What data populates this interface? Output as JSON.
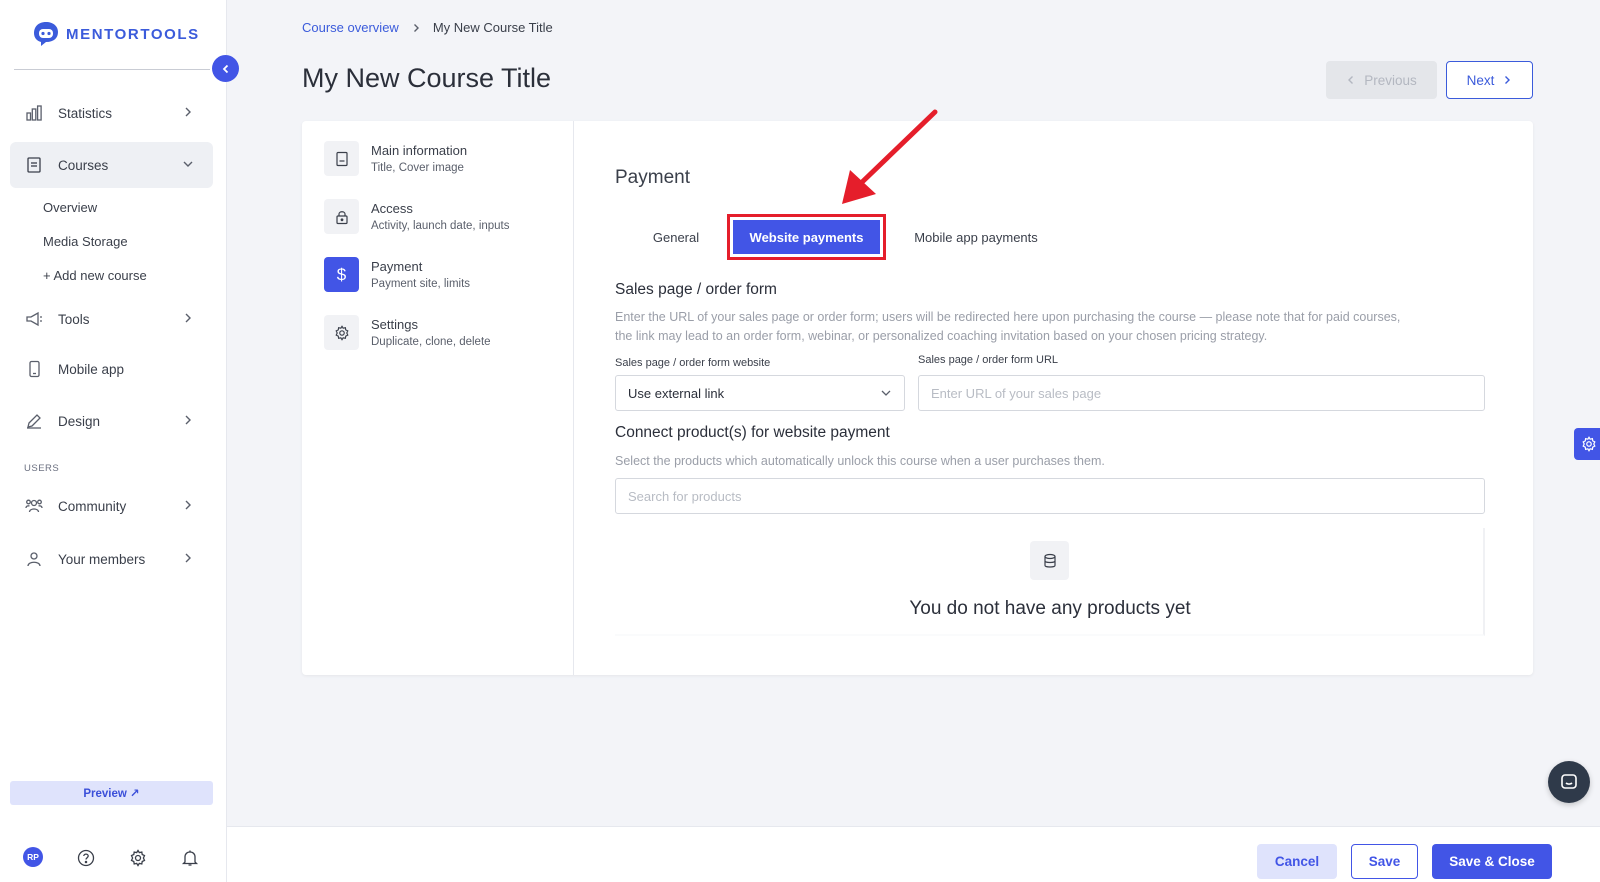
{
  "brand": {
    "name": "MENTORTOOLS",
    "color": "#3b5bdb"
  },
  "sidebar": {
    "items": [
      {
        "label": "Statistics",
        "icon": "bar-chart-icon",
        "has_chevron": true
      },
      {
        "label": "Courses",
        "icon": "book-icon",
        "expanded": true
      },
      {
        "label": "Tools",
        "icon": "megaphone-icon",
        "has_chevron": true
      },
      {
        "label": "Mobile app",
        "icon": "phone-icon",
        "has_chevron": false
      },
      {
        "label": "Design",
        "icon": "pencil-icon",
        "has_chevron": true
      },
      {
        "label": "Community",
        "icon": "people-icon",
        "has_chevron": true
      },
      {
        "label": "Your members",
        "icon": "user-icon",
        "has_chevron": true
      }
    ],
    "sub_items": [
      "Overview",
      "Media Storage",
      "+ Add new course"
    ],
    "section_users": "USERS",
    "preview": "Preview ↗",
    "avatar_initials": "RP"
  },
  "breadcrumb": {
    "parent": "Course overview",
    "current": "My New Course Title"
  },
  "page_title": "My New Course Title",
  "nav_buttons": {
    "previous": "Previous",
    "next": "Next"
  },
  "steps": [
    {
      "title": "Main information",
      "subtitle": "Title, Cover image",
      "icon": "document-icon"
    },
    {
      "title": "Access",
      "subtitle": "Activity, launch date, inputs",
      "icon": "lock-icon"
    },
    {
      "title": "Payment",
      "subtitle": "Payment site, limits",
      "icon": "dollar-icon",
      "active": true
    },
    {
      "title": "Settings",
      "subtitle": "Duplicate, clone, delete",
      "icon": "gear-icon"
    }
  ],
  "payment": {
    "title": "Payment",
    "tabs": [
      "General",
      "Website payments",
      "Mobile app payments"
    ],
    "active_tab": "Website payments",
    "sales": {
      "title": "Sales page / order form",
      "desc_line1": "Enter the URL of your sales page or order form; users will be redirected here upon purchasing the course — please note that for paid courses,",
      "desc_line2": "the link may lead to an order form, webinar, or personalized coaching invitation based on your chosen pricing strategy.",
      "website_label": "Sales page / order form website",
      "website_value": "Use external link",
      "url_label": "Sales page / order form URL",
      "url_placeholder": "Enter URL of your sales page"
    },
    "products": {
      "title": "Connect product(s) for website payment",
      "desc": "Select the products which automatically unlock this course when a user purchases them.",
      "search_placeholder": "Search for products",
      "empty_text": "You do not have any products yet"
    }
  },
  "footer": {
    "cancel": "Cancel",
    "save": "Save",
    "save_close": "Save & Close"
  },
  "colors": {
    "accent": "#4255e6",
    "highlight": "#e51e2b"
  }
}
